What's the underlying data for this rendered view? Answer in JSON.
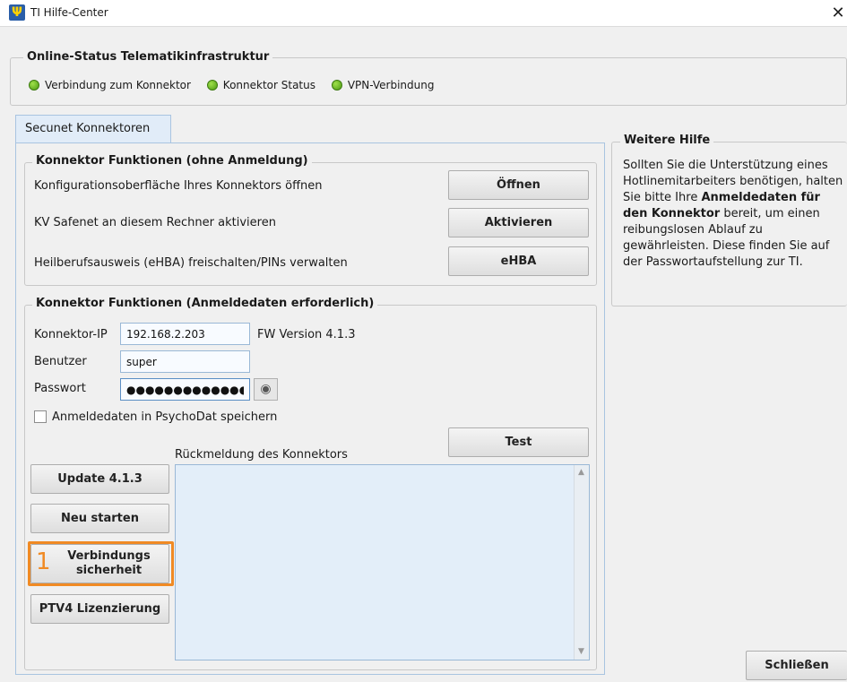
{
  "window": {
    "title": "TI Hilfe-Center",
    "icon": "psi-icon",
    "close": "✕"
  },
  "status": {
    "legend": "Online-Status Telematikinfrastruktur",
    "items": [
      {
        "label": "Verbindung zum Konnektor",
        "color": "#5cb81e"
      },
      {
        "label": "Konnektor Status",
        "color": "#5cb81e"
      },
      {
        "label": "VPN-Verbindung",
        "color": "#5cb81e"
      }
    ]
  },
  "tabs": [
    {
      "label": "Secunet Konnektoren",
      "active": true
    }
  ],
  "no_login": {
    "legend": "Konnektor Funktionen (ohne Anmeldung)",
    "rows": [
      {
        "label": "Konfigurationsoberfläche Ihres Konnektors öffnen",
        "button": "Öffnen"
      },
      {
        "label": "KV Safenet an diesem Rechner aktivieren",
        "button": "Aktivieren"
      },
      {
        "label": "Heilberufsausweis (eHBA) freischalten/PINs verwalten",
        "button": "eHBA"
      }
    ]
  },
  "login": {
    "legend": "Konnektor Funktionen (Anmeldedaten erforderlich)",
    "ip_label": "Konnektor-IP",
    "ip_value": "192.168.2.203",
    "fw_version": "FW Version 4.1.3",
    "user_label": "Benutzer",
    "user_value": "super",
    "pass_label": "Passwort",
    "pass_value": "●●●●●●●●●●●●●●",
    "save_label": "Anmeldedaten in PsychoDat speichern",
    "test_button": "Test",
    "feedback_label": "Rückmeldung des Konnektors",
    "buttons": {
      "update": "Update 4.1.3",
      "restart": "Neu starten",
      "security_line1": "Verbindungs",
      "security_line2": "sicherheit",
      "ptv4": "PTV4 Lizenzierung"
    }
  },
  "annotation": {
    "number": "1",
    "color": "#f08a24"
  },
  "help": {
    "legend": "Weitere Hilfe",
    "text1": "Sollten Sie die Unterstützung eines Hotlinemitarbeiters benötigen, halten Sie bitte Ihre",
    "bold": "Anmeldedaten für den Konnektor",
    "text2": "bereit, um einen reibungslosen Ablauf zu gewährleisten. Diese finden Sie auf der Passwortaufstellung zur TI."
  },
  "close_button": "Schließen"
}
